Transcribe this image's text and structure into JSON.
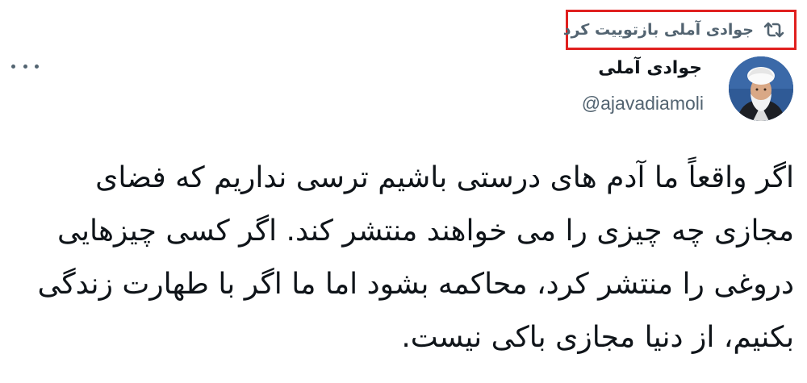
{
  "retweet": {
    "label": "جوادی آملی بازتوییت کرد",
    "icon": "retweet-icon"
  },
  "more_menu": {
    "icon": "more-dots-icon"
  },
  "author": {
    "display_name": "جوادی آملی",
    "handle": "@ajavadiamoli",
    "avatar": "avatar-portrait"
  },
  "tweet": {
    "lines": [
      "اگر واقعاً ما آدم های درستی باشیم ترسی نداریم که فضای",
      "مجازی چه چیزی را می خواهند منتشر کند. اگر کسی چیزهایی",
      "دروغی را منتشر کرد، محاکمه بشود اما ما اگر با طهارت زندگی",
      "بکنیم، از دنیا مجازی باکی نیست."
    ]
  },
  "colors": {
    "highlight_border": "#e0201f",
    "secondary_text": "#536471",
    "primary_text": "#0f1419"
  }
}
